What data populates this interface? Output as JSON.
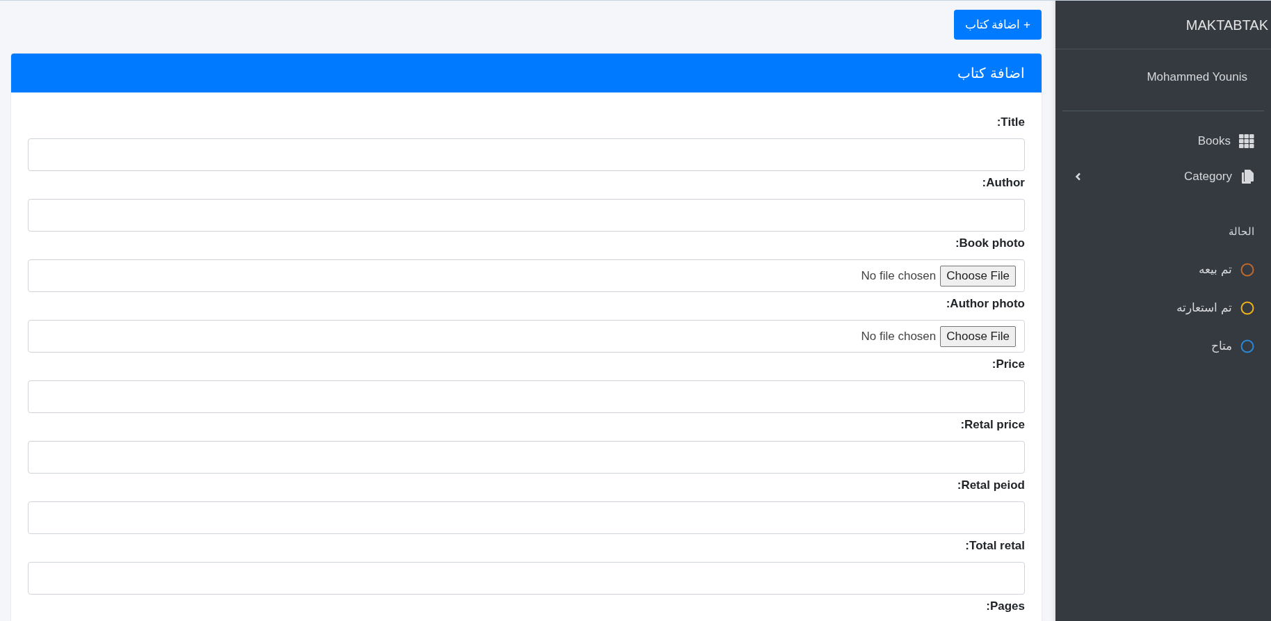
{
  "toolbar": {
    "add_button": "+ اضافة كتاب"
  },
  "card": {
    "title": "اضافة كتاب",
    "fields": [
      {
        "kind": "text",
        "label": "Title:"
      },
      {
        "kind": "text",
        "label": "Author:"
      },
      {
        "kind": "file",
        "label": "Book photo:",
        "button": "Choose File",
        "status": "No file chosen"
      },
      {
        "kind": "file",
        "label": "Author photo:",
        "button": "Choose File",
        "status": "No file chosen"
      },
      {
        "kind": "text",
        "label": "Price:"
      },
      {
        "kind": "text",
        "label": "Retal price:"
      },
      {
        "kind": "text",
        "label": "Retal peiod:"
      },
      {
        "kind": "text",
        "label": "Total retal:"
      },
      {
        "kind": "label",
        "label": "Pages:"
      }
    ]
  },
  "sidebar": {
    "brand": "MAKTABTAK",
    "user": "Mohammed Younis",
    "nav": [
      {
        "label": "Books",
        "kind": "grid",
        "expandable": false
      },
      {
        "label": "Category",
        "kind": "copy",
        "expandable": true
      }
    ],
    "status_header": "الحالة",
    "statuses": [
      {
        "label": "تم بيعه",
        "color": "#c0692f"
      },
      {
        "label": "تم استعارته",
        "color": "#f2b21b"
      },
      {
        "label": "متاح",
        "color": "#2b88d8"
      }
    ]
  }
}
